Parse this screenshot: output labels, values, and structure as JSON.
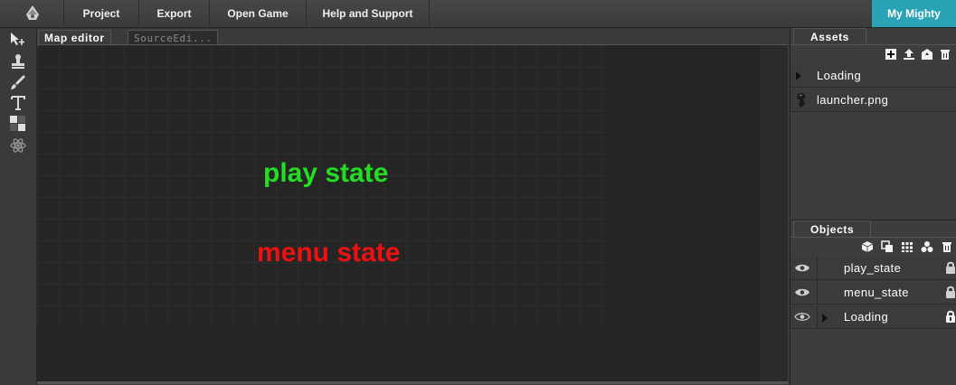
{
  "topbar": {
    "menu": [
      "Project",
      "Export",
      "Open Game",
      "Help and Support"
    ],
    "account_label": "My Mighty",
    "accent_color": "#2aa3b5"
  },
  "tools": {
    "icons": [
      "select-move-icon",
      "stamp-icon",
      "brush-icon",
      "text-tool-icon",
      "tile-icon",
      "atom-icon"
    ]
  },
  "editor": {
    "tabs": [
      "Map editor",
      "SourceEdi..."
    ],
    "active_tab": "Map editor"
  },
  "canvas": {
    "labels": [
      {
        "text": "play state",
        "color": "#22dd22"
      },
      {
        "text": "menu state",
        "color": "#ee1111"
      }
    ]
  },
  "assets": {
    "title": "Assets",
    "toolbar_icons": [
      "add-asset-icon",
      "upload-icon",
      "import-folder-icon",
      "delete-icon"
    ],
    "items": [
      {
        "label": "Loading",
        "type": "folder"
      },
      {
        "label": "launcher.png",
        "type": "image"
      }
    ]
  },
  "objects": {
    "title": "Objects",
    "toolbar_icons": [
      "add-object-icon",
      "clone-icon",
      "grid-icon",
      "group-icon",
      "delete-icon"
    ],
    "items": [
      {
        "label": "play_state",
        "expandable": false
      },
      {
        "label": "menu_state",
        "expandable": false
      },
      {
        "label": "Loading",
        "expandable": true
      }
    ]
  }
}
